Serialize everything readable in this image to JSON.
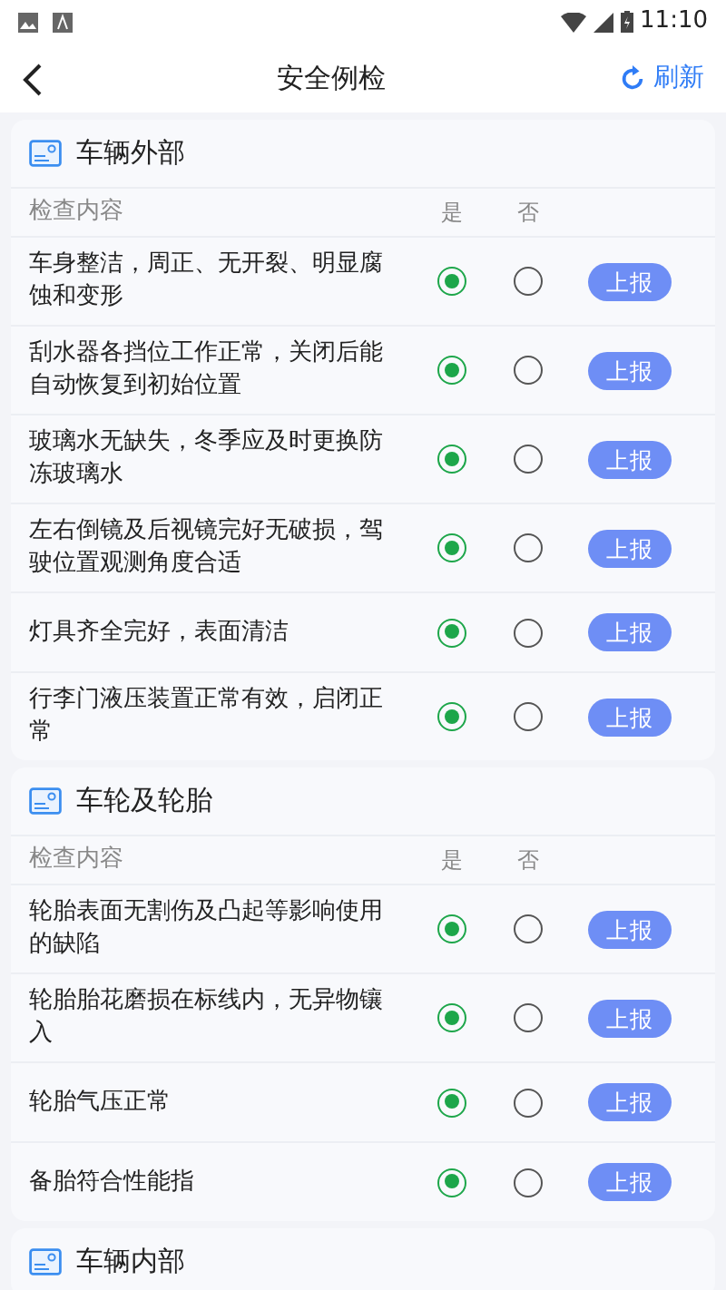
{
  "status_bar": {
    "time": "11:10"
  },
  "header": {
    "title": "安全例检",
    "refresh": "刷新"
  },
  "sections": [
    {
      "title": "车辆外部",
      "column_headers": {
        "content": "检查内容",
        "yes": "是",
        "no": "否"
      },
      "items": [
        {
          "text": "车身整洁，周正、无开裂、明显腐蚀和变形",
          "choices": [
            {
              "selected": true
            },
            {
              "selected": false
            }
          ],
          "report": "上报"
        },
        {
          "text": "刮水器各挡位工作正常，关闭后能自动恢复到初始位置",
          "choices": [
            {
              "selected": true
            },
            {
              "selected": false
            }
          ],
          "report": "上报"
        },
        {
          "text": "玻璃水无缺失，冬季应及时更换防冻玻璃水",
          "choices": [
            {
              "selected": true
            },
            {
              "selected": false
            }
          ],
          "report": "上报"
        },
        {
          "text": "左右倒镜及后视镜完好无破损，驾驶位置观测角度合适",
          "choices": [
            {
              "selected": true
            },
            {
              "selected": false
            }
          ],
          "report": "上报"
        },
        {
          "text": "灯具齐全完好，表面清洁",
          "choices": [
            {
              "selected": true
            },
            {
              "selected": false
            }
          ],
          "report": "上报"
        },
        {
          "text": "行李门液压装置正常有效，启闭正常",
          "choices": [
            {
              "selected": true
            },
            {
              "selected": false
            }
          ],
          "report": "上报"
        }
      ]
    },
    {
      "title": "车轮及轮胎",
      "column_headers": {
        "content": "检查内容",
        "yes": "是",
        "no": "否"
      },
      "items": [
        {
          "text": "轮胎表面无割伤及凸起等影响使用的缺陷",
          "choices": [
            {
              "selected": true
            },
            {
              "selected": false
            }
          ],
          "report": "上报"
        },
        {
          "text": "轮胎胎花磨损在标线内，无异物镶入",
          "choices": [
            {
              "selected": true
            },
            {
              "selected": false
            }
          ],
          "report": "上报"
        },
        {
          "text": "轮胎气压正常",
          "choices": [
            {
              "selected": true
            },
            {
              "selected": false
            }
          ],
          "report": "上报"
        },
        {
          "text": "备胎符合性能指",
          "choices": [
            {
              "selected": true
            },
            {
              "selected": false
            }
          ],
          "report": "上报"
        }
      ]
    },
    {
      "title": "车辆内部"
    }
  ]
}
